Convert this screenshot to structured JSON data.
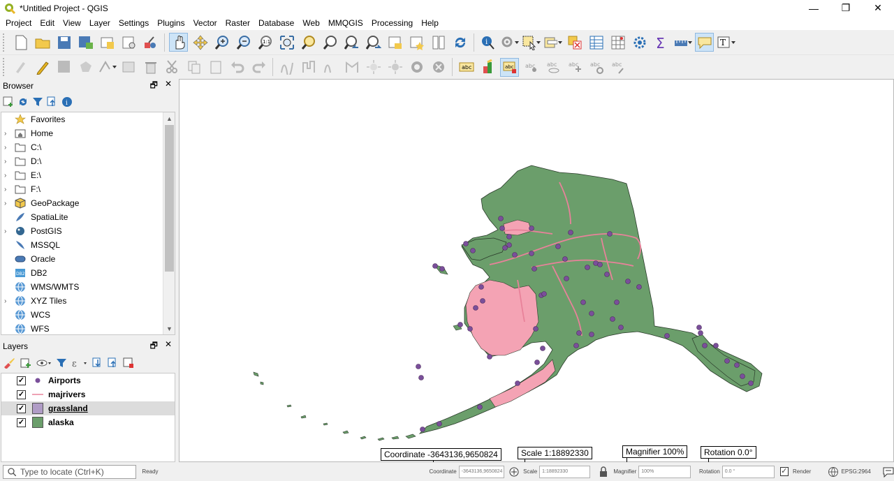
{
  "window": {
    "title": "*Untitled Project - QGIS",
    "controls": [
      "—",
      "❐",
      "✕"
    ]
  },
  "menu": [
    "Project",
    "Edit",
    "View",
    "Layer",
    "Settings",
    "Plugins",
    "Vector",
    "Raster",
    "Database",
    "Web",
    "MMQGIS",
    "Processing",
    "Help"
  ],
  "browser": {
    "title": "Browser",
    "items": [
      {
        "label": "Favorites",
        "icon": "star-icon",
        "expandable": false
      },
      {
        "label": "Home",
        "icon": "home-folder-icon",
        "expandable": true
      },
      {
        "label": "C:\\",
        "icon": "drive-icon",
        "expandable": true
      },
      {
        "label": "D:\\",
        "icon": "drive-icon",
        "expandable": true
      },
      {
        "label": "E:\\",
        "icon": "drive-icon",
        "expandable": true
      },
      {
        "label": "F:\\",
        "icon": "drive-icon",
        "expandable": true
      },
      {
        "label": "GeoPackage",
        "icon": "geopackage-icon",
        "expandable": true
      },
      {
        "label": "SpatiaLite",
        "icon": "spatialite-icon",
        "expandable": false
      },
      {
        "label": "PostGIS",
        "icon": "postgis-icon",
        "expandable": true
      },
      {
        "label": "MSSQL",
        "icon": "mssql-icon",
        "expandable": false
      },
      {
        "label": "Oracle",
        "icon": "oracle-icon",
        "expandable": false
      },
      {
        "label": "DB2",
        "icon": "db2-icon",
        "expandable": false
      },
      {
        "label": "WMS/WMTS",
        "icon": "globe-icon",
        "expandable": false
      },
      {
        "label": "XYZ Tiles",
        "icon": "globe-icon",
        "expandable": true
      },
      {
        "label": "WCS",
        "icon": "globe-icon",
        "expandable": false
      },
      {
        "label": "WFS",
        "icon": "globe-icon",
        "expandable": false
      }
    ]
  },
  "layers": {
    "title": "Layers",
    "items": [
      {
        "name": "Airports",
        "symbol": "point",
        "color": "#7a4f9a",
        "checked": true,
        "selected": false
      },
      {
        "name": "majrivers",
        "symbol": "line",
        "color": "#e8829a",
        "checked": true,
        "selected": false
      },
      {
        "name": "grassland",
        "symbol": "fill",
        "color": "#b09cc6",
        "checked": true,
        "selected": true
      },
      {
        "name": "alaska",
        "symbol": "fill",
        "color": "#6b9e6b",
        "checked": true,
        "selected": false
      }
    ]
  },
  "status": {
    "locator_placeholder": "Type to locate (Ctrl+K)",
    "ready": "Ready",
    "coordinate_label": "Coordinate",
    "coordinate_value": "-3643136,9650824",
    "scale_label": "Scale",
    "scale_value": "1:18892330",
    "magnifier_label": "Magnifier",
    "magnifier_value": "100%",
    "rotation_label": "Rotation",
    "rotation_value": "0.0 °",
    "render_label": "Render",
    "crs": "EPSG:2964"
  },
  "callouts": {
    "coordinate": "Coordinate -3643136,9650824",
    "scale": "Scale  1:18892330",
    "magnifier": "Magnifier 100%",
    "rotation": "Rotation 0.0°"
  },
  "colors": {
    "land": "#6b9e6b",
    "grassland": "#f4a3b4",
    "rivers": "#e8829a",
    "airports": "#7a4f9a",
    "accent": "#2a6fb5"
  }
}
